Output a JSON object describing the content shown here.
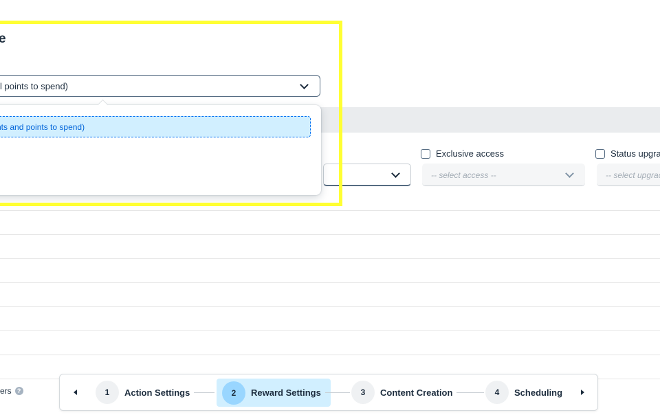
{
  "section": {
    "title": "e"
  },
  "reward_type_select": {
    "value": "l points to spend)",
    "options": [
      {
        "label": "nts and points to spend)",
        "selected": true
      }
    ]
  },
  "exclusive_access": {
    "label": "Exclusive access",
    "placeholder": "-- select access --"
  },
  "status_upgrade": {
    "label": "Status upgrad",
    "placeholder": "-- select upgrac"
  },
  "tiers": {
    "label": "tiers",
    "help_icon": "?"
  },
  "wizard": {
    "steps": [
      {
        "number": "1",
        "label": "Action Settings",
        "active": false
      },
      {
        "number": "2",
        "label": "Reward Settings",
        "active": true
      },
      {
        "number": "3",
        "label": "Content Creation",
        "active": false
      },
      {
        "number": "4",
        "label": "Scheduling",
        "active": false
      }
    ],
    "prev_icon": "caret-left-icon",
    "next_icon": "caret-right-icon"
  },
  "colors": {
    "highlight": "#ffff33",
    "selected_option_bg": "#d1efff",
    "selected_option_text": "#0064d9",
    "active_step_bg": "#d1efff",
    "active_step_circle": "#99d6ff",
    "header_band": "#eaecee"
  }
}
